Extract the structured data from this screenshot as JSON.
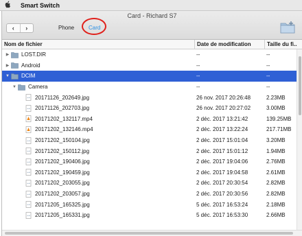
{
  "menubar": {
    "app_name": "Smart Switch",
    "apple_icon": "apple-logo-icon"
  },
  "window": {
    "title": "Card - Richard S7",
    "tabs": [
      {
        "label": "Phone"
      },
      {
        "label": "Card",
        "active": true
      }
    ],
    "annotation_color": "#e0201b"
  },
  "table": {
    "columns": [
      "Nom de fichier",
      "Date de modification",
      "Taille du fi..."
    ],
    "selected_color": "#2f60d5",
    "rows": [
      {
        "name": "LOST.DIR",
        "kind": "folder",
        "date": "--",
        "size": "--",
        "depth": 0,
        "expander": "collapsed"
      },
      {
        "name": "Android",
        "kind": "folder",
        "date": "--",
        "size": "--",
        "depth": 0,
        "expander": "collapsed"
      },
      {
        "name": "DCIM",
        "kind": "folder",
        "date": "--",
        "size": "--",
        "depth": 0,
        "expander": "expanded",
        "selected": true
      },
      {
        "name": "Camera",
        "kind": "folder",
        "date": "--",
        "size": "--",
        "depth": 1,
        "expander": "expanded"
      },
      {
        "name": "20171126_202649.jpg",
        "kind": "image",
        "date": "26 nov. 2017 20:26:48",
        "size": "2.23MB",
        "depth": 2
      },
      {
        "name": "20171126_202703.jpg",
        "kind": "image",
        "date": "26 nov. 2017 20:27:02",
        "size": "3.00MB",
        "depth": 2
      },
      {
        "name": "20171202_132117.mp4",
        "kind": "video",
        "date": "2 déc. 2017 13:21:42",
        "size": "139.25MB",
        "depth": 2
      },
      {
        "name": "20171202_132146.mp4",
        "kind": "video",
        "date": "2 déc. 2017 13:22:24",
        "size": "217.71MB",
        "depth": 2
      },
      {
        "name": "20171202_150104.jpg",
        "kind": "image",
        "date": "2 déc. 2017 15:01:04",
        "size": "3.20MB",
        "depth": 2
      },
      {
        "name": "20171202_150112.jpg",
        "kind": "image",
        "date": "2 déc. 2017 15:01:12",
        "size": "1.94MB",
        "depth": 2
      },
      {
        "name": "20171202_190406.jpg",
        "kind": "image",
        "date": "2 déc. 2017 19:04:06",
        "size": "2.76MB",
        "depth": 2
      },
      {
        "name": "20171202_190459.jpg",
        "kind": "image",
        "date": "2 déc. 2017 19:04:58",
        "size": "2.61MB",
        "depth": 2
      },
      {
        "name": "20171202_203055.jpg",
        "kind": "image",
        "date": "2 déc. 2017 20:30:54",
        "size": "2.82MB",
        "depth": 2
      },
      {
        "name": "20171202_203057.jpg",
        "kind": "image",
        "date": "2 déc. 2017 20:30:56",
        "size": "2.82MB",
        "depth": 2
      },
      {
        "name": "20171205_165325.jpg",
        "kind": "image",
        "date": "5 déc. 2017 16:53:24",
        "size": "2.18MB",
        "depth": 2
      },
      {
        "name": "20171205_165331.jpg",
        "kind": "image",
        "date": "5 déc. 2017 16:53:30",
        "size": "2.66MB",
        "depth": 2
      }
    ]
  }
}
